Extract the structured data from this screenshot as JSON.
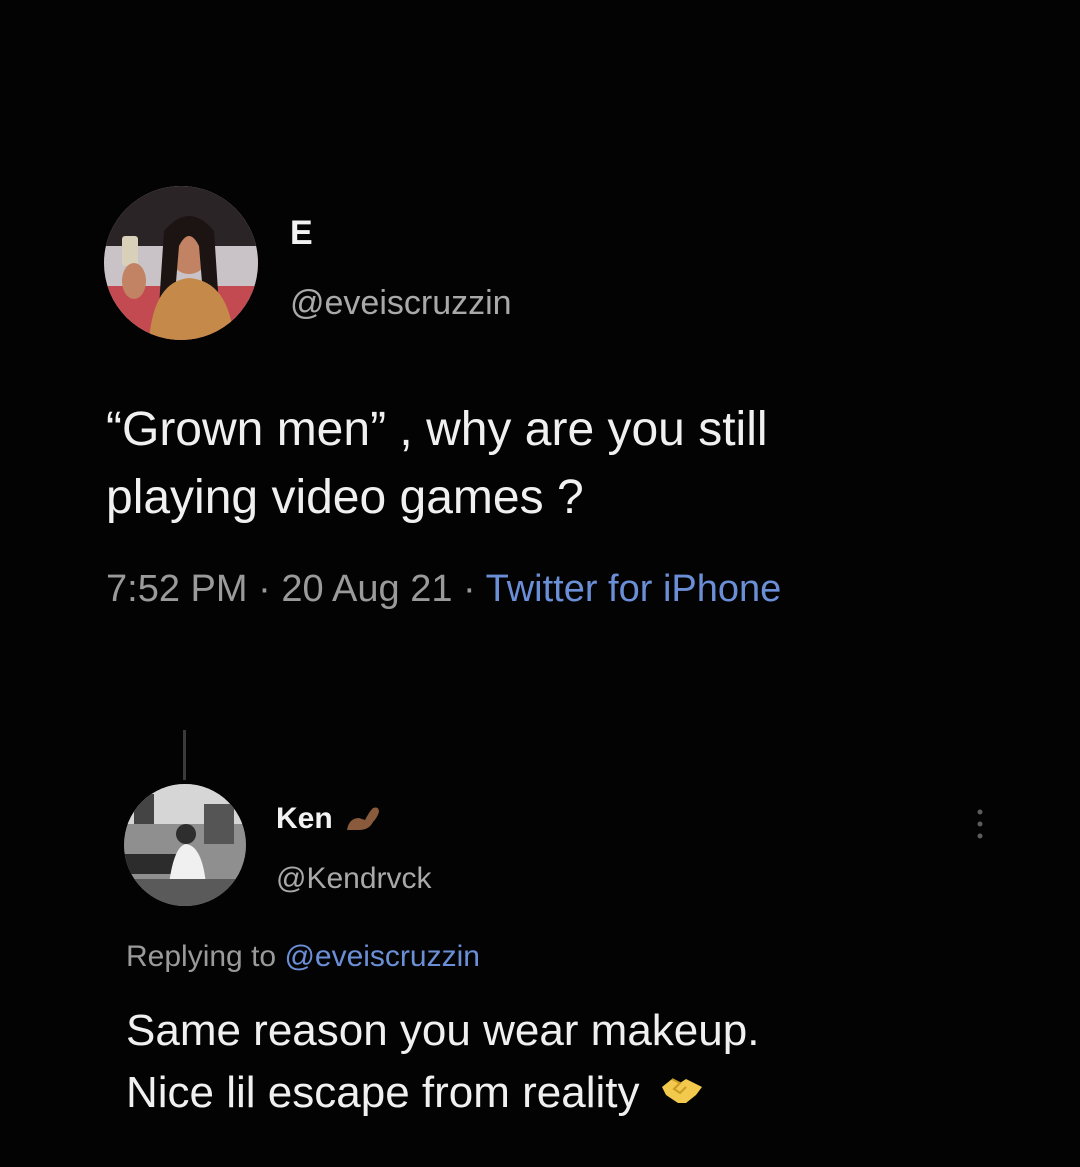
{
  "original": {
    "display_name": "E",
    "handle": "@eveiscruzzin",
    "text_line1": "“Grown men” , why are you still",
    "text_line2": "playing video games ?",
    "time": "7:52 PM",
    "date": "20 Aug 21",
    "source": "Twitter for iPhone",
    "separator": " · "
  },
  "reply": {
    "display_name": "Ken",
    "handle": "@Kendrvck",
    "replying_to_label": "Replying to ",
    "replying_to_handle": "@eveiscruzzin",
    "text_line1": "Same reason you wear makeup.",
    "text_line2": "Nice lil escape from reality",
    "name_emoji": "flexed-arm-emoji",
    "text_emoji": "handshake-emoji"
  },
  "colors": {
    "background": "#030303",
    "link": "#6b8fd6",
    "muted": "#9a9a9a"
  }
}
